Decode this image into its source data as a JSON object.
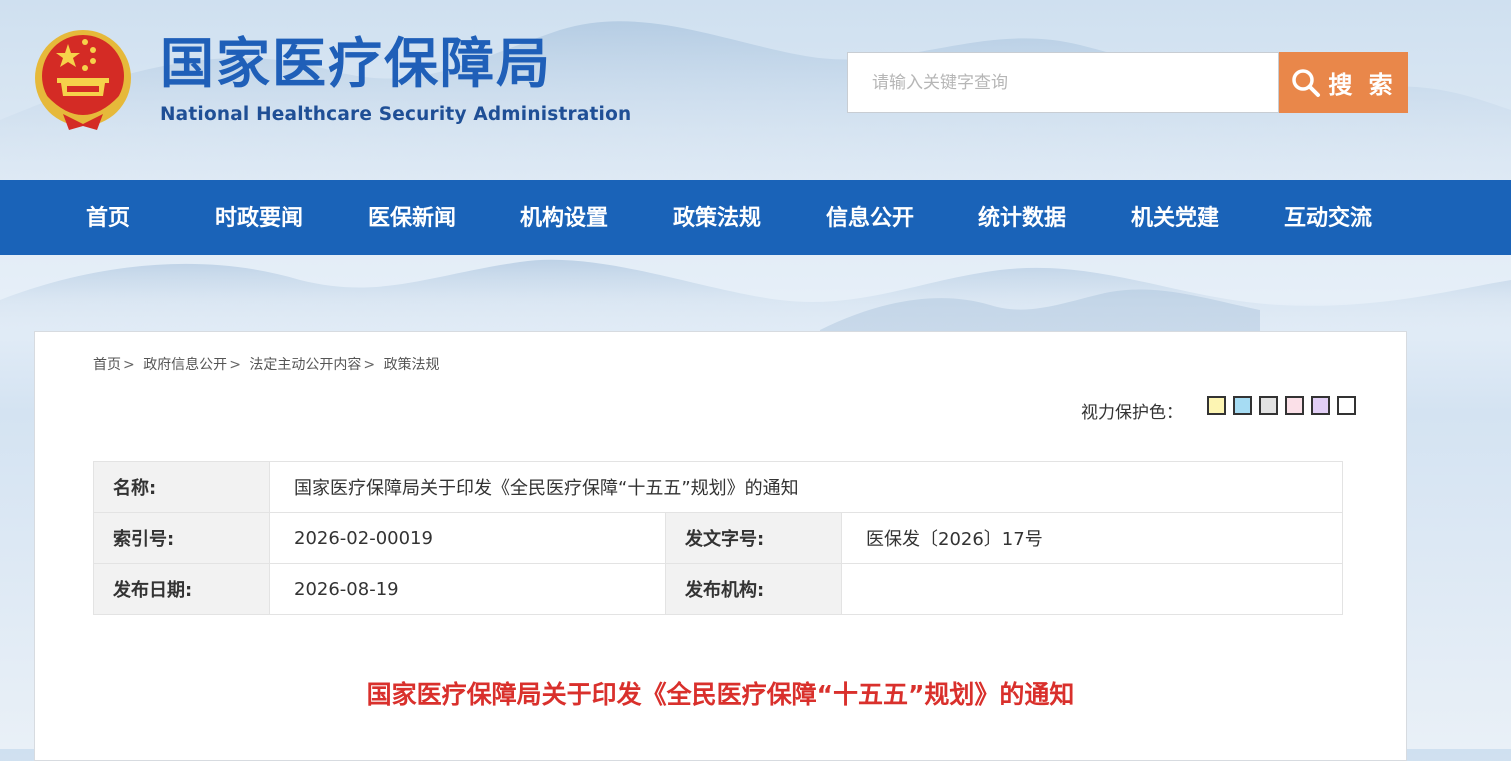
{
  "header": {
    "site_title": "国家医疗保障局",
    "site_subtitle": "National Healthcare Security Administration",
    "emblem_icon": "national-emblem-icon"
  },
  "search": {
    "placeholder": "请输入关键字查询",
    "button_label": "搜 索",
    "button_color": "#e9874a"
  },
  "nav": {
    "background": "#1a63b8",
    "items": [
      {
        "label": "首页"
      },
      {
        "label": "时政要闻"
      },
      {
        "label": "医保新闻"
      },
      {
        "label": "机构设置"
      },
      {
        "label": "政策法规"
      },
      {
        "label": "信息公开"
      },
      {
        "label": "统计数据"
      },
      {
        "label": "机关党建"
      },
      {
        "label": "互动交流"
      }
    ]
  },
  "breadcrumb": {
    "items": [
      {
        "label": "首页"
      },
      {
        "label": "政府信息公开"
      },
      {
        "label": "法定主动公开内容"
      },
      {
        "label": "政策法规"
      }
    ],
    "separator": ">"
  },
  "eye_care": {
    "label": "视力保护色：",
    "swatches": [
      "#fdf5b3",
      "#a6dcf3",
      "#e2e2e2",
      "#fbe0e8",
      "#e2cff6",
      "#ffffff"
    ]
  },
  "meta": {
    "name_label": "名称:",
    "name_value": "国家医疗保障局关于印发《全民医疗保障“十五五”规划》的通知",
    "index_label": "索引号:",
    "index_value": "2026-02-00019",
    "doc_no_label": "发文字号:",
    "doc_no_value": "医保发〔2026〕17号",
    "date_label": "发布日期:",
    "date_value": "2026-08-19",
    "org_label": "发布机构:",
    "org_value": ""
  },
  "document": {
    "title": "国家医疗保障局关于印发《全民医疗保障“十五五”规划》的通知",
    "title_color": "#d9302c"
  }
}
